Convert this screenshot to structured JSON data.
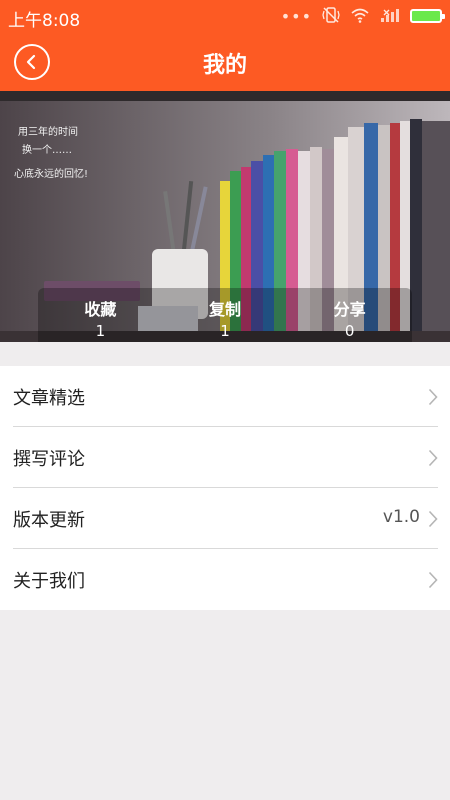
{
  "status_bar": {
    "time": "上午8:08",
    "dots": "•••",
    "icons": [
      "vibrate-icon",
      "wifi-icon",
      "signal-icon",
      "battery-icon"
    ],
    "battery_color": "#6ae94b"
  },
  "header": {
    "title": "我的",
    "background": "#fd5a23"
  },
  "banner": {
    "handwriting": [
      "用三年的时间",
      "换一个……",
      "心底永远的回忆!"
    ],
    "stats": [
      {
        "label": "收藏",
        "count": "1"
      },
      {
        "label": "复制",
        "count": "1"
      },
      {
        "label": "分享",
        "count": "0"
      }
    ]
  },
  "menu": {
    "items": [
      {
        "label": "文章精选",
        "value": ""
      },
      {
        "label": "撰写评论",
        "value": ""
      },
      {
        "label": "版本更新",
        "value": "v1.0"
      },
      {
        "label": "关于我们",
        "value": ""
      }
    ]
  }
}
